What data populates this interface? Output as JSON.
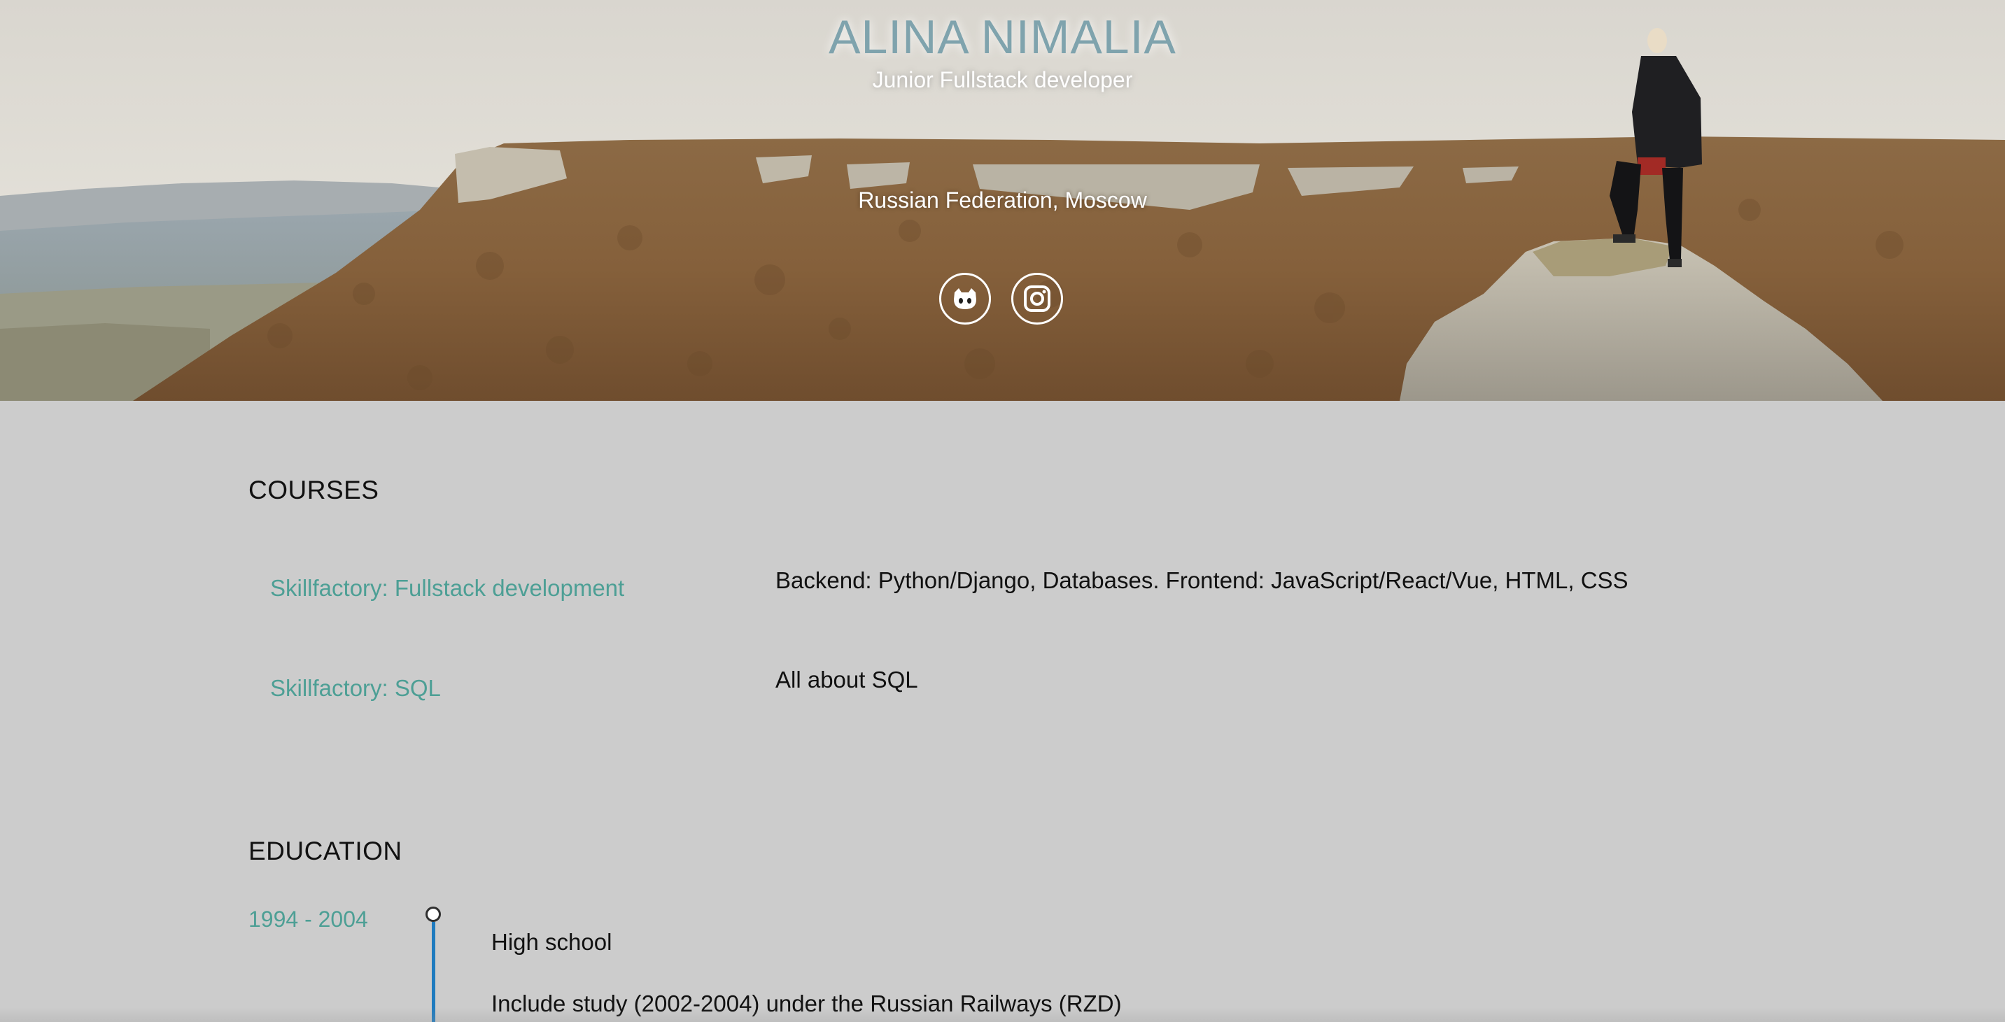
{
  "hero": {
    "name": "ALINA NIMALIA",
    "subtitle": "Junior Fullstack developer",
    "location": "Russian Federation, Moscow",
    "social": [
      {
        "icon": "github-icon"
      },
      {
        "icon": "instagram-icon"
      }
    ]
  },
  "courses": {
    "title": "COURSES",
    "items": [
      {
        "name": "Skillfactory: Fullstack development",
        "description": "Backend: Python/Django, Databases. Frontend: JavaScript/React/Vue, HTML, CSS"
      },
      {
        "name": "Skillfactory: SQL",
        "description": "All about SQL"
      }
    ]
  },
  "education": {
    "title": "EDUCATION",
    "items": [
      {
        "years": "1994 - 2004",
        "title": "High school",
        "note": "Include study (2002-2004) under the Russian Railways (RZD)"
      }
    ]
  },
  "colors": {
    "accent": "#4d9f95",
    "timeline": "#1f7bbf",
    "background": "#cccccc"
  }
}
